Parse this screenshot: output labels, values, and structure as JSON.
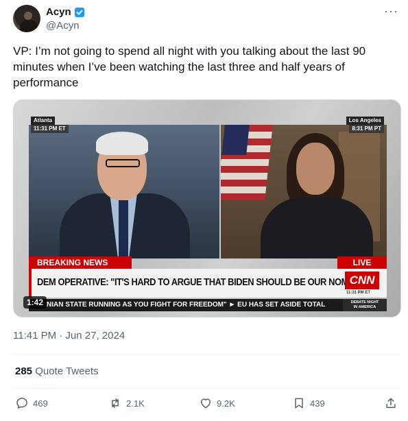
{
  "author": {
    "display_name": "Acyn",
    "handle": "@Acyn",
    "verified_icon": "verified-badge-icon",
    "verified_color": "#1d9bf0"
  },
  "more_icon": "more-options-icon",
  "tweet_text": "VP: I’m not going to spend all night with you talking about the last 90 minutes when I’ve been watching the last three and half years of performance",
  "media": {
    "duration": "1:42",
    "left_location": "Atlanta",
    "left_time": "11:31 PM ET",
    "right_location": "Los Angeles",
    "right_time": "8:31 PM PT",
    "breaking_label": "BREAKING NEWS",
    "live_label": "LIVE",
    "headline": "DEM OPERATIVE: \"IT'S HARD TO ARGUE THAT BIDEN SHOULD BE OUR NOMINEE\"",
    "network_logo": "CNN",
    "network_time": "11:31 PM ET",
    "ticker": "NIAN STATE RUNNING AS YOU FIGHT FOR FREEDOM\"  ► EU HAS SET ASIDE TOTAL",
    "program_line1": "DEBATE NIGHT",
    "program_line2": "IN AMERICA",
    "accent_color": "#cc0000"
  },
  "timestamp": "11:41 PM · Jun 27, 2024",
  "quote_tweets": {
    "count": "285",
    "label": "Quote Tweets"
  },
  "actions": {
    "replies": "469",
    "retweets": "2.1K",
    "likes": "9.2K",
    "bookmarks": "439"
  },
  "colors": {
    "text_primary": "#0f1419",
    "text_secondary": "#536471",
    "divider": "#eff3f4"
  }
}
